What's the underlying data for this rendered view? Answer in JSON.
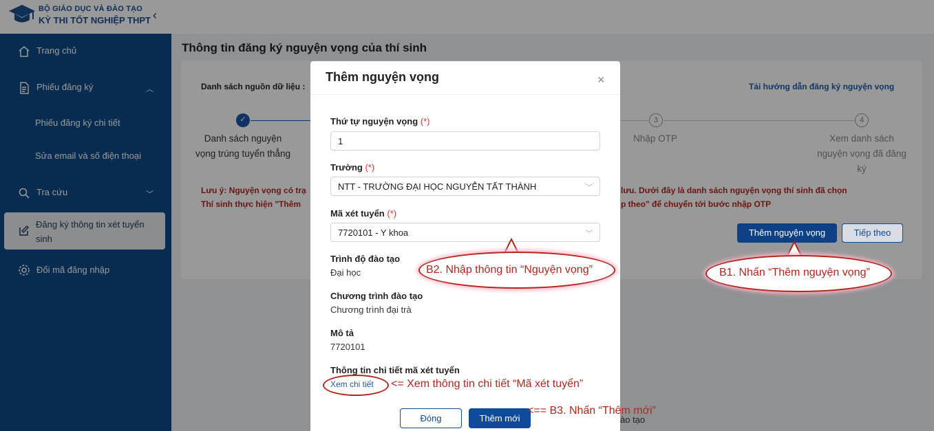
{
  "header": {
    "brand_line1": "BỘ GIÁO DỤC VÀ ĐÀO TẠO",
    "brand_line2": "KỲ THI TỐT NGHIỆP THPT",
    "collapse_glyph": "‹"
  },
  "sidebar": {
    "home": "Trang chủ",
    "registration": "Phiếu đăng ký",
    "registration_detail": "Phiếu đăng ký chi tiết",
    "edit_contact": "Sửa email và số điện thoại",
    "lookup": "Tra cứu",
    "admission_register": "Đăng ký thông tin xét tuyển sinh",
    "change_password": "Đổi mã đăng nhập"
  },
  "main": {
    "page_title": "Thông tin đăng ký nguyện vọng của thí sinh",
    "source_label": "Danh sách nguồn dữ liệu :",
    "guide_link": "Tải hướng dẫn đăng ký nguyện vọng",
    "steps": [
      {
        "number": "",
        "label": "Danh sách nguyện vọng trúng tuyển thẳng"
      },
      {
        "number": "3",
        "label": "Nhập OTP"
      },
      {
        "number": "4",
        "label": "Xem danh sách nguyện vọng đã đăng ký"
      }
    ],
    "note_line1_left": "Lưu ý: Nguyện vọng có trạ",
    "note_line1_right": "lưu. Dưới đây là danh sách nguyện vọng thí sinh đã chọn",
    "note_line2_left": "Thí sinh thực hiện \"Thêm",
    "note_line2_right": "p theo\" để chuyển tới bước nhập OTP",
    "add_button": "Thêm nguyện vọng",
    "next_button": "Tiếp theo",
    "behind_modal_text": "ào tạo"
  },
  "modal": {
    "title": "Thêm nguyện vọng",
    "close": "×",
    "order_label": "Thứ tự nguyện vọng",
    "required_mark": "(*)",
    "order_value": "1",
    "school_label": "Trường",
    "school_value": "NTT - TRƯỜNG ĐẠI HỌC NGUYỄN TẤT THÀNH",
    "code_label": "Mã xét tuyển",
    "code_value": "7720101 - Y khoa",
    "level_label": "Trình độ đào tạo",
    "level_value": "Đại học",
    "program_label": "Chương trình đào tạo",
    "program_value": "Chương trình đại trà",
    "desc_label": "Mô tả",
    "desc_value": "7720101",
    "detail_label": "Thông tin chi tiết mã xét tuyển",
    "detail_link": "Xem chi tiết",
    "close_button": "Đóng",
    "add_new_button": "Thêm mới"
  },
  "annotations": {
    "b1": "B1. Nhấn “Thêm nguyện vọng”",
    "b2": "B2. Nhập thông tin “Nguyện vọng”",
    "detail": "<= Xem thông tin chi tiết “Mã xét tuyển”",
    "b3": "<== B3. Nhấn “Thêm mới”"
  },
  "colors": {
    "sidebar": "#0e4a85",
    "primary": "#0f4b9a",
    "warning": "#b3261e",
    "annotation": "#b3261e"
  }
}
